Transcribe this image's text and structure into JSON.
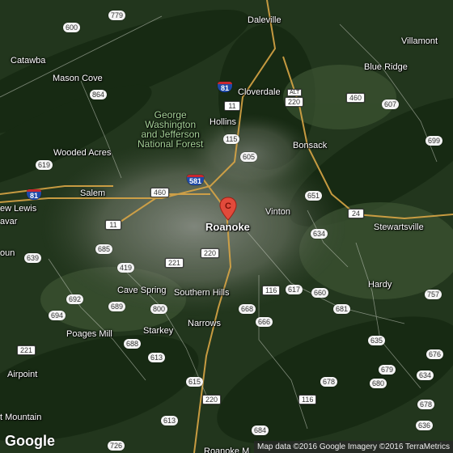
{
  "map": {
    "places": {
      "daleville": "Daleville",
      "villamont": "Villamont",
      "catawba": "Catawba",
      "blue_ridge": "Blue Ridge",
      "mason_cove": "Mason Cove",
      "cloverdale": "Cloverdale",
      "hollins": "Hollins",
      "forest_1": "George",
      "forest_2": "Washington",
      "forest_3": "and Jefferson",
      "forest_4": "National Forest",
      "bonsack": "Bonsack",
      "wooded_acres": "Wooded Acres",
      "salem": "Salem",
      "new_lewis": "ew Lewis",
      "vinton": "Vinton",
      "roanoke": "Roanoke",
      "stewartsville": "Stewartsville",
      "shavar": "avar",
      "goun": "oun",
      "cave_spring": "Cave Spring",
      "southern_hills": "Southern Hills",
      "hardy": "Hardy",
      "poages_mill": "Poages Mill",
      "starkey": "Starkey",
      "narrows": "Narrows",
      "airpoint": "Airpoint",
      "bent_mountain": "t Mountain",
      "bottom_label": "Roanoke M"
    },
    "shields": {
      "r779": "779",
      "r600": "600",
      "r864": "864",
      "i81a": "81",
      "r11a": "11",
      "alt": "ALT",
      "r220a": "220",
      "r460a": "460",
      "r607": "607",
      "r699": "699",
      "r115": "115",
      "r605": "605",
      "r619": "619",
      "i581": "581",
      "r460b": "460",
      "i81b": "81",
      "r651": "651",
      "r24": "24",
      "r11b": "11",
      "r634": "634",
      "r639": "639",
      "r685": "685",
      "r221a": "221",
      "r220b": "220",
      "r419": "419",
      "r116": "116",
      "r617": "617",
      "r660": "660",
      "r692": "692",
      "r689": "689",
      "r800": "800",
      "r668": "668",
      "r681": "681",
      "r757": "757",
      "r694": "694",
      "r666": "666",
      "r688": "688",
      "r613a": "613",
      "r635": "635",
      "r221b": "221",
      "r679": "679",
      "r676": "676",
      "r634b": "634",
      "r615": "615",
      "r678a": "678",
      "r680": "680",
      "r220c": "220",
      "r116b": "116",
      "r678b": "678",
      "r613b": "613",
      "r684": "684",
      "r726": "726",
      "r636": "636"
    },
    "pin_letter": "C",
    "logo": "Google",
    "attribution": "Map data ©2016 Google  Imagery ©2016 TerraMetrics"
  }
}
